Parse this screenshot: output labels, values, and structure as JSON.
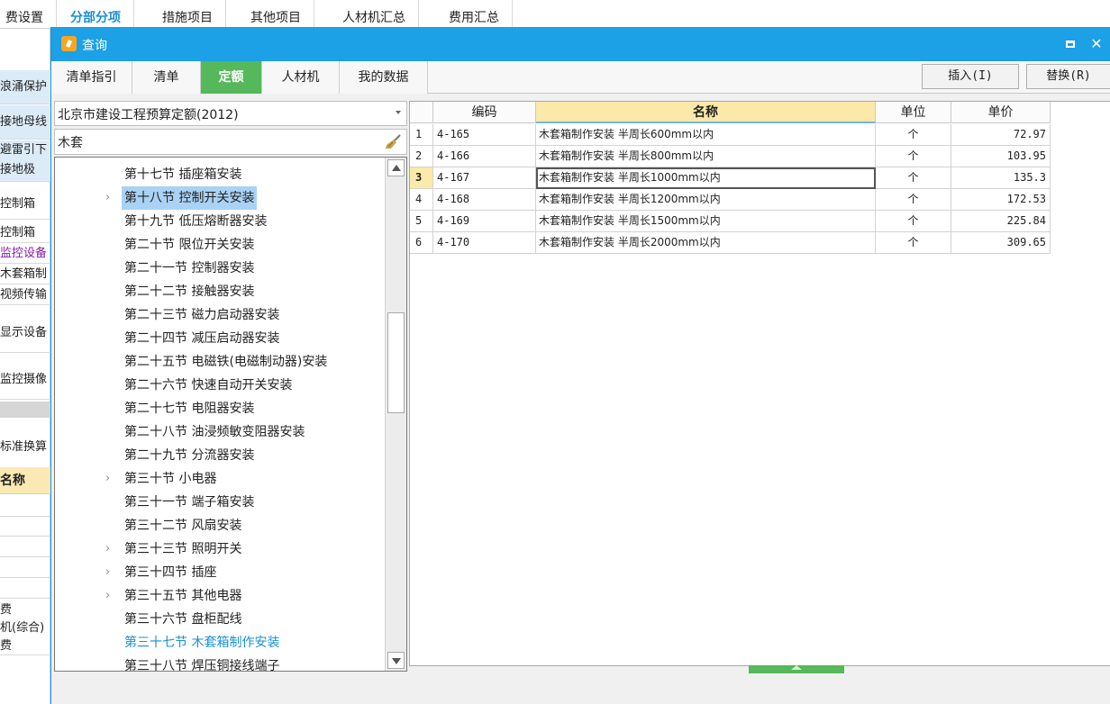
{
  "app_tabs": [
    "费设置",
    "分部分项",
    "措施项目",
    "其他项目",
    "人材机汇总",
    "费用汇总"
  ],
  "bg_rows": [
    "浪涌保护",
    "接地母线",
    "避雷引下",
    "接地极",
    "控制箱",
    "控制箱",
    "监控设备",
    "木套箱制",
    "视频传输",
    "显示设备",
    "监控摄像",
    "标准换算"
  ],
  "bg_header": "名称",
  "bg_lower": [
    "费",
    "机(综合)",
    "费"
  ],
  "dialog": {
    "title": "查询",
    "tabs": [
      "清单指引",
      "清单",
      "定额",
      "人材机",
      "我的数据"
    ],
    "active_tab": "定额",
    "insert_label": "插入(I)",
    "replace_label": "替换(R)"
  },
  "combo_value": "北京市建设工程预算定额(2012)",
  "search_value": "木套",
  "tree": [
    {
      "label": "第十七节 插座箱安装",
      "expandable": false
    },
    {
      "label": "第十八节 控制开关安装",
      "expandable": true,
      "selected": true
    },
    {
      "label": "第十九节 低压熔断器安装",
      "expandable": false
    },
    {
      "label": "第二十节 限位开关安装",
      "expandable": false
    },
    {
      "label": "第二十一节 控制器安装",
      "expandable": false
    },
    {
      "label": "第二十二节 接触器安装",
      "expandable": false
    },
    {
      "label": "第二十三节 磁力启动器安装",
      "expandable": false
    },
    {
      "label": "第二十四节 减压启动器安装",
      "expandable": false
    },
    {
      "label": "第二十五节 电磁铁(电磁制动器)安装",
      "expandable": false
    },
    {
      "label": "第二十六节 快速自动开关安装",
      "expandable": false
    },
    {
      "label": "第二十七节 电阻器安装",
      "expandable": false
    },
    {
      "label": "第二十八节 油浸频敏变阻器安装",
      "expandable": false
    },
    {
      "label": "第二十九节 分流器安装",
      "expandable": false
    },
    {
      "label": "第三十节 小电器",
      "expandable": true
    },
    {
      "label": "第三十一节 端子箱安装",
      "expandable": false
    },
    {
      "label": "第三十二节 风扇安装",
      "expandable": false
    },
    {
      "label": "第三十三节 照明开关",
      "expandable": true
    },
    {
      "label": "第三十四节 插座",
      "expandable": true
    },
    {
      "label": "第三十五节 其他电器",
      "expandable": true
    },
    {
      "label": "第三十六节 盘柜配线",
      "expandable": false
    },
    {
      "label": "第三十七节 木套箱制作安装",
      "expandable": false,
      "highlight": true
    },
    {
      "label": "第三十八节 焊压铜接线端子",
      "expandable": false
    }
  ],
  "grid": {
    "headers": {
      "code": "编码",
      "name": "名称",
      "unit": "单位",
      "price": "单价"
    },
    "rows": [
      {
        "no": "1",
        "code": "4-165",
        "name": "木套箱制作安装 半周长600mm以内",
        "unit": "个",
        "price": "72.97"
      },
      {
        "no": "2",
        "code": "4-166",
        "name": "木套箱制作安装 半周长800mm以内",
        "unit": "个",
        "price": "103.95"
      },
      {
        "no": "3",
        "code": "4-167",
        "name": "木套箱制作安装 半周长1000mm以内",
        "unit": "个",
        "price": "135.3"
      },
      {
        "no": "4",
        "code": "4-168",
        "name": "木套箱制作安装 半周长1200mm以内",
        "unit": "个",
        "price": "172.53"
      },
      {
        "no": "5",
        "code": "4-169",
        "name": "木套箱制作安装 半周长1500mm以内",
        "unit": "个",
        "price": "225.84"
      },
      {
        "no": "6",
        "code": "4-170",
        "name": "木套箱制作安装 半周长2000mm以内",
        "unit": "个",
        "price": "309.65"
      }
    ],
    "current_row": "3"
  }
}
